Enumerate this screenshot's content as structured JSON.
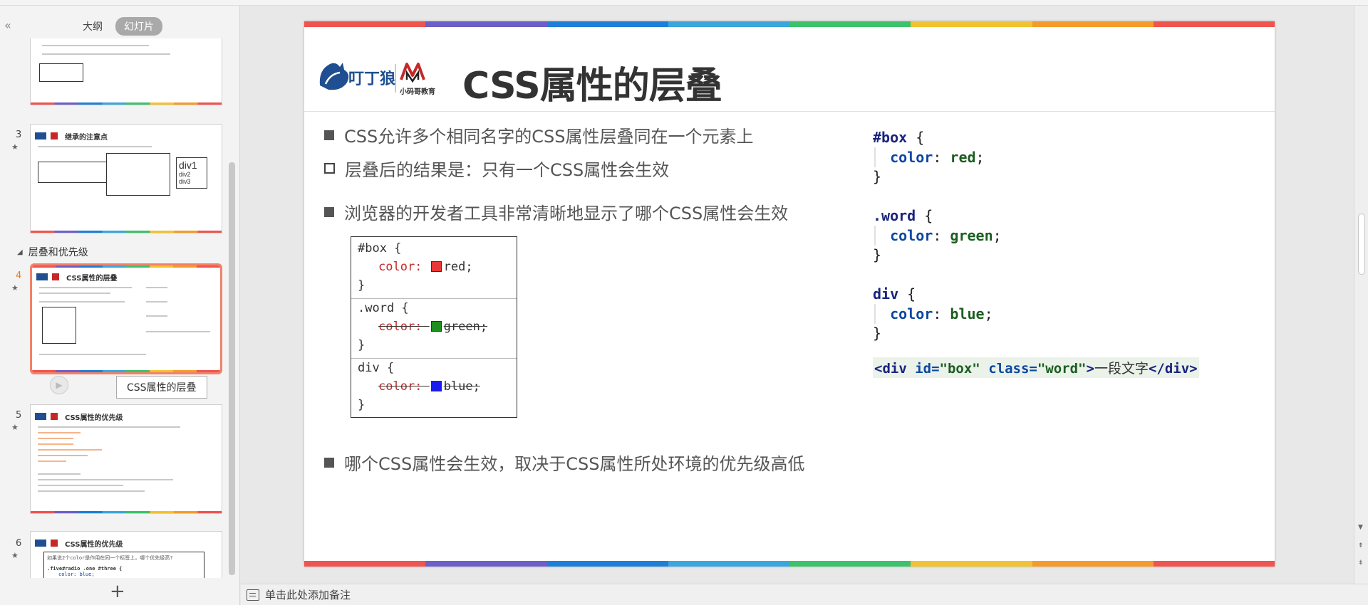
{
  "panel": {
    "collapse_glyph": "«",
    "tabs": [
      "大纲",
      "幻灯片"
    ],
    "active_tab": "幻灯片",
    "section_label": "层叠和优先级",
    "tooltip": "CSS属性的层叠",
    "add_slide": "+"
  },
  "thumbnails": [
    {
      "num": "3",
      "title": "继承的注意点",
      "box_label": "div1",
      "box_sub1": "div2",
      "box_sub2": "div3"
    },
    {
      "num": "4",
      "title": "CSS属性的层叠"
    },
    {
      "num": "5",
      "title": "CSS属性的优先级"
    },
    {
      "num": "6",
      "title": "CSS属性的优先级",
      "code_preview": "如果说2个color是作用在同一个标签上，哪个优先级高?",
      "code_line2": ".five#radio .one #three {",
      "code_line3": "color: blue;"
    }
  ],
  "slide": {
    "title": "CSS属性的层叠",
    "logo_text": "小码哥教育",
    "bullets": [
      "CSS允许多个相同名字的CSS属性层叠同在一个元素上",
      "层叠后的结果是：只有一个CSS属性会生效",
      "浏览器的开发者工具非常清晰地显示了哪个CSS属性会生效",
      "哪个CSS属性会生效，取决于CSS属性所处环境的优先级高低"
    ],
    "devtools": {
      "rules": [
        {
          "selector": "#box {",
          "prop": "color:",
          "value": "red;",
          "swatch": "#e53935",
          "struck": false
        },
        {
          "selector": ".word {",
          "prop": "color:",
          "value": "green;",
          "swatch": "#1e8e1e",
          "struck": true
        },
        {
          "selector": "div {",
          "prop": "color:",
          "value": "blue;",
          "swatch": "#1a1aee",
          "struck": true
        }
      ],
      "close": "}"
    },
    "code": {
      "blocks": [
        {
          "selector": "#box",
          "prop": "color",
          "value": "red"
        },
        {
          "selector": ".word",
          "prop": "color",
          "value": "green"
        },
        {
          "selector": "div",
          "prop": "color",
          "value": "blue"
        }
      ],
      "html_open": "<div",
      "attr_id": "id=",
      "val_id": "\"box\"",
      "attr_class": "class=",
      "val_class": "\"word\"",
      "gt": ">",
      "text": "一段文字",
      "html_close": "</div>"
    }
  },
  "notes": {
    "placeholder": "单击此处添加备注"
  },
  "colors": {
    "accent_selected": "#f0826a",
    "rainbow": [
      "#f0544f",
      "#6c5fc7",
      "#1f7ed8",
      "#3aa6dc",
      "#3ec16b",
      "#f1c232",
      "#f39c2b",
      "#f0544f"
    ]
  }
}
